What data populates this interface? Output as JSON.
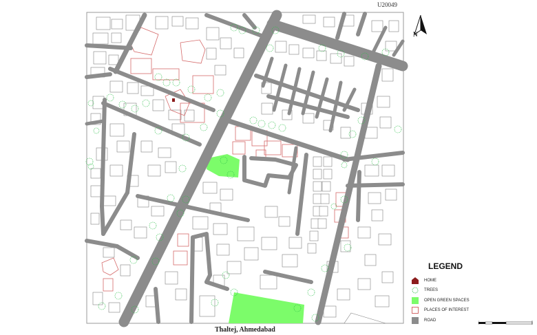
{
  "map_code": "U20049",
  "caption": "Thaltej, Ahmedabad",
  "north_label": "N",
  "legend": {
    "title": "LEGEND",
    "items": [
      {
        "key": "home",
        "label": "HOME",
        "color": "#8b1c1c"
      },
      {
        "key": "trees",
        "label": "TREES",
        "color": "#2fbf4a"
      },
      {
        "key": "green",
        "label": "OPEN GREEN SPACES",
        "color": "#7cfc6a"
      },
      {
        "key": "poi",
        "label": "PLACES OF INTEREST",
        "color": "#e08b8b"
      },
      {
        "key": "road",
        "label": "ROAD",
        "color": "#8c8c8c"
      }
    ]
  },
  "colors": {
    "road": "#8c8c8c",
    "building": "#ffffff",
    "building_stroke": "#777777",
    "poi_stroke": "#d56a6a",
    "green": "#7cfc6a",
    "tree": "#2fbf4a",
    "home": "#8b1c1c"
  }
}
